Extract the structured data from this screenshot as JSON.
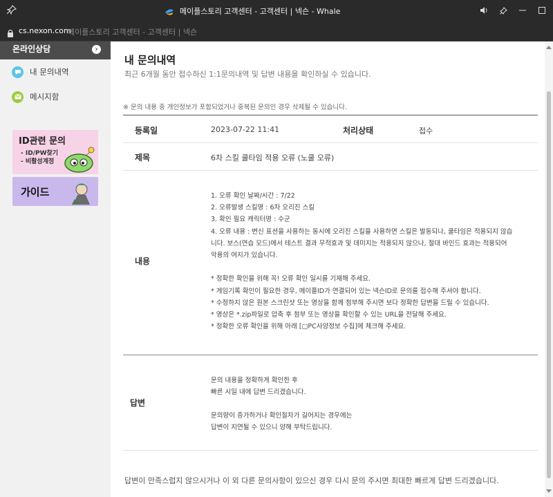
{
  "window": {
    "title": "메이플스토리 고객센터 - 고객센터 | 넥슨 - Whale",
    "controls": [
      "speaker",
      "pin",
      "minimize",
      "maximize",
      "close"
    ]
  },
  "urlbar": {
    "domain": "cs.nexon.com",
    "page_title": "메이플스토리 고객센터 - 고객센터 | 넥슨"
  },
  "sidebar": {
    "header": "온라인상담",
    "items": [
      {
        "label": "내 문의내역",
        "icon": "chat-bubble-icon",
        "color": "#5ec5e6"
      },
      {
        "label": "메시지함",
        "icon": "mail-icon",
        "color": "#9ccc3c"
      }
    ],
    "banners": [
      {
        "title": "ID관련 문의",
        "lines": [
          "- ID/PW찾기",
          "- 비활성계정"
        ]
      },
      {
        "title": "가이드"
      }
    ]
  },
  "main": {
    "title": "내 문의내역",
    "subtitle": "최근 6개월 동안 접수하신 1:1문의내역 및 답변 내용을 확인하실 수 있습니다.",
    "notice": "※ 문의 내용 중 개인정보가 포함되었거나 중복된 문의인 경우 삭제될 수 있습니다.",
    "date_label": "등록일",
    "date_value": "2023-07-22 11:41",
    "status_label": "처리상태",
    "status_value": "접수",
    "subject_label": "제목",
    "subject_value": "6차 스킬 쿨타임 적용 오류 (노쿨 오류)",
    "content_label": "내용",
    "content_lines": [
      "1. 오류 확인 날짜/시간 : 7/22",
      "2. 오류발생 스킬명 : 6차 오리진 스킬",
      "3. 확인 필요 캐릭터명 : 수군",
      "4. 오류 내용 : 변신 표션을 사용하는 동시에 오리진 스킬을 사용하면 스킬은 발동되나, 쿨타임은 적용되지 않습",
      "니다. 보스(연습 모드)에서 테스트 결과 무적효과 및 데미지는 적용되지 않으나, 절대 바인드 효과는 적용되어",
      "악용의 여지가 있습니다.",
      "",
      "* 정확한 확인을 위해 꼭! 오류 확인 일시를 기재해 주세요.",
      "* 게임기록 확인이 필요한 경우, 메이플ID가 연결되어 있는 넥슨ID로 문의를 접수해 주셔야 합니다.",
      "* 수정하지 않은 원본 스크린샷 또는 영상을 함께 첨부해 주시면 보다 정확한 답변을 드릴 수 있습니다.",
      "* 영상은 *.zip파일로 압축 후 첨부 또는 영상을 확인할 수 있는 URL을 전달해 주세요.",
      "* 정확한 오류 확인을 위해 아래 [▢PC사양정보 수집]에 체크해 주세요."
    ],
    "answer_label": "답변",
    "answer_lines": [
      "문의 내용을 정확하게 확인한 후",
      "빠른 시일 내에 답변 드리겠습니다.",
      "",
      "문의량이 증가하거나 확인절차가 길어지는 경우에는",
      "답변이 지연될 수 있으니 양해 부탁드립니다."
    ],
    "footer": "답변이 만족스럽지 않으시거나 이 외 다른 문의사항이 있으신 경우 다시 문의 주시면 최대한 빠르게 답변 드리겠습니다."
  }
}
